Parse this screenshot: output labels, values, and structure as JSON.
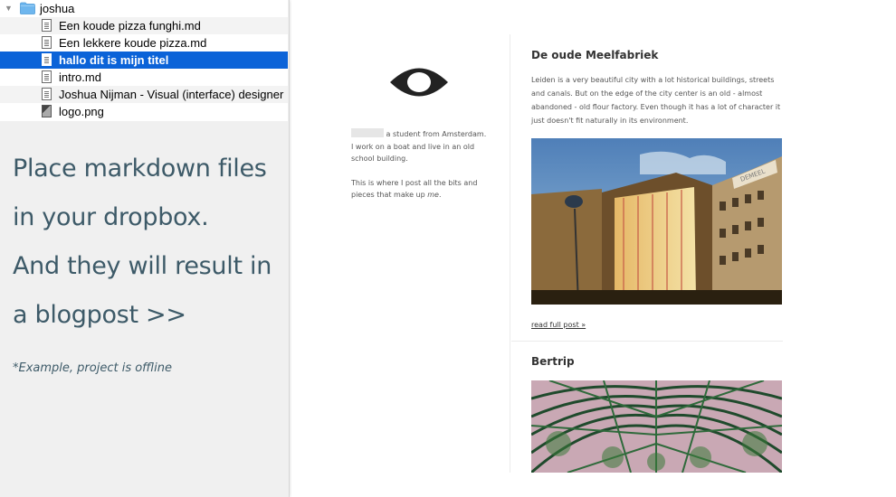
{
  "finder": {
    "folder": "joshua",
    "files": [
      {
        "label": "Een koude pizza funghi.md",
        "type": "doc"
      },
      {
        "label": "Een lekkere koude pizza.md",
        "type": "doc"
      },
      {
        "label": "hallo dit is mijn titel",
        "type": "doc",
        "selected": true
      },
      {
        "label": "intro.md",
        "type": "doc"
      },
      {
        "label": "Joshua Nijman - Visual (interface) designer",
        "type": "doc"
      },
      {
        "label": "logo.png",
        "type": "image"
      }
    ]
  },
  "promo": {
    "lines": [
      "Place markdown files",
      "in your dropbox.",
      "And they will result in",
      "a blogpost >>"
    ],
    "note": "*Example, project is offline"
  },
  "blog": {
    "bio": {
      "p1": "a student from Amsterdam. I work on a boat and live in an old school building.",
      "p2_prefix": "This is where I post all the bits and pieces that make up ",
      "p2_em": "me",
      "p2_suffix": "."
    },
    "posts": [
      {
        "title": "De oude Meelfabriek",
        "excerpt": "Leiden is a very beautiful city with a lot historical buildings, streets and canals. But on the edge of the city center is an old - almost abandoned - old flour factory. Even though it has a lot of character it just doesn't fit naturally in its environment.",
        "read_more": "read full post »",
        "sign_text": "DEMEEL"
      },
      {
        "title": "Bertrip"
      }
    ]
  },
  "colors": {
    "selection": "#0b63d8",
    "folder": "#6eb6ee",
    "promo_text": "#3d5a68"
  }
}
